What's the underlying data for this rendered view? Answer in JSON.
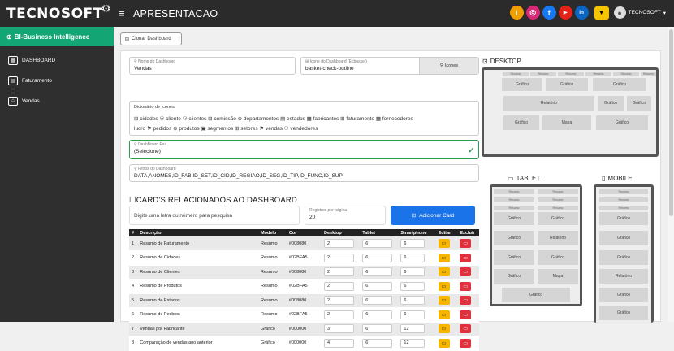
{
  "header": {
    "logo_text": "TECNOSOFT",
    "menu_icon": "hamburger-icon",
    "title": "APRESENTACAO",
    "social": [
      {
        "name": "info-icon",
        "glyph": "i",
        "color": "#f0a000"
      },
      {
        "name": "instagram-icon",
        "glyph": "◎",
        "color": "#d62976"
      },
      {
        "name": "facebook-icon",
        "glyph": "f",
        "color": "#1877f2"
      },
      {
        "name": "youtube-icon",
        "glyph": "▶",
        "color": "#e62117"
      },
      {
        "name": "linkedin-icon",
        "glyph": "in",
        "color": "#0a66c2"
      }
    ],
    "notify_glyph": "▼",
    "user_name": "TECNOSOFT",
    "user_caret": "▾"
  },
  "sidebar": {
    "header": "BI-Business Intelligence",
    "items": [
      {
        "label": "DASHBOARD",
        "glyph": "▦"
      },
      {
        "label": "Faturamento",
        "glyph": "▤"
      },
      {
        "label": "Vendas",
        "glyph": "⌂"
      }
    ]
  },
  "form": {
    "clone_label": "Clonar Dashboard",
    "name_label": "Nome do Dashboard",
    "name_value": "Vendas",
    "icon_label": "Icone do Dashboard (Ecbasket)",
    "icon_value": "basket-check-outline",
    "icons_button": "Icones",
    "icons_dict_title": "Dicionário de ícones:",
    "icons_row1": "⊞ cidades  ⚇ cliente  ⚇ clientes  ⊞ comissão  ⊕ departamentos  ▤ estados  ▦ fabricantes  ⊞ faturamento  ▦ fornecedores",
    "icons_row2": "lucro  ⚑ pedidos  ⊕ produtos  ▣ segmentos  ⊞ setores  ⚑ vendas  ⚇ vendedores",
    "parent_label": "DashBoard Pai",
    "parent_value": "(Selecione)",
    "filters_label": "Filtros do Dashboard",
    "filters_value": "DATA,ANOMES,ID_FAB,ID_SET,ID_CID,ID_REGIAO,ID_SEG,ID_TIP,ID_FUNC,ID_SUP"
  },
  "cards": {
    "title": "CARD'S RELACIONADOS AO DASHBOARD",
    "search_placeholder": "Digite uma letra ou número para pesquisa",
    "per_page_label": "Registros por página",
    "per_page_value": "20",
    "add_button": "Adicionar Card",
    "columns": [
      "#",
      "Descrição",
      "Modelo",
      "Cor",
      "Desktop",
      "Tablet",
      "Smartphone",
      "Editar",
      "Excluir"
    ],
    "rows": [
      {
        "n": "1",
        "desc": "Resumo de Faturamento",
        "modelo": "Resumo",
        "cor": "#008080",
        "desktop": "2",
        "tablet": "6",
        "smart": "6"
      },
      {
        "n": "2",
        "desc": "Resumo de Cidades",
        "modelo": "Resumo",
        "cor": "#02BFA5",
        "desktop": "2",
        "tablet": "6",
        "smart": "6"
      },
      {
        "n": "3",
        "desc": "Resumo de Clientes",
        "modelo": "Resumo",
        "cor": "#008080",
        "desktop": "2",
        "tablet": "6",
        "smart": "6"
      },
      {
        "n": "4",
        "desc": "Resumo de Produtos",
        "modelo": "Resumo",
        "cor": "#02BFA5",
        "desktop": "2",
        "tablet": "6",
        "smart": "6"
      },
      {
        "n": "5",
        "desc": "Resumo de Estados",
        "modelo": "Resumo",
        "cor": "#008080",
        "desktop": "2",
        "tablet": "6",
        "smart": "6"
      },
      {
        "n": "6",
        "desc": "Resumo de Pedidos",
        "modelo": "Resumo",
        "cor": "#02BFA5",
        "desktop": "2",
        "tablet": "6",
        "smart": "6"
      },
      {
        "n": "7",
        "desc": "Vendas por Fabricante",
        "modelo": "Gráfico",
        "cor": "#000000",
        "desktop": "3",
        "tablet": "6",
        "smart": "12"
      },
      {
        "n": "8",
        "desc": "Comparação de vendas ano anterior",
        "modelo": "Gráfico",
        "cor": "#000000",
        "desktop": "4",
        "tablet": "6",
        "smart": "12"
      }
    ]
  },
  "preview": {
    "desktop_title": "DESKTOP",
    "tablet_title": "TABLET",
    "mobile_title": "MOBILE",
    "resumo": "Resumo",
    "grafico": "Gráfico",
    "relatorio": "Relatório",
    "mapa": "Mapa"
  }
}
